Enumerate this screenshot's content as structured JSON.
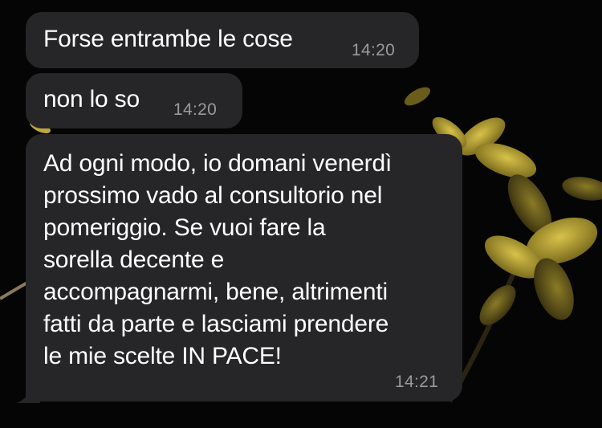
{
  "colors": {
    "background": "#050505",
    "bubble": "#262628",
    "text": "#ffffff",
    "timestamp": "#9a9a9e",
    "flower": "#b9a23a"
  },
  "wallpaper": {
    "icon": "yellow-flower-icon"
  },
  "messages": [
    {
      "text": "Forse entrambe le cose",
      "time": "14:20"
    },
    {
      "text": "non lo so",
      "time": "14:20"
    },
    {
      "text": "Ad ogni modo, io domani venerdì\nprossimo vado al consultorio nel\npomeriggio. Se vuoi fare la\nsorella decente e\naccompagnarmi, bene, altrimenti\nfatti da parte e lasciami prendere\nle mie scelte IN PACE!",
      "time": "14:21"
    }
  ]
}
